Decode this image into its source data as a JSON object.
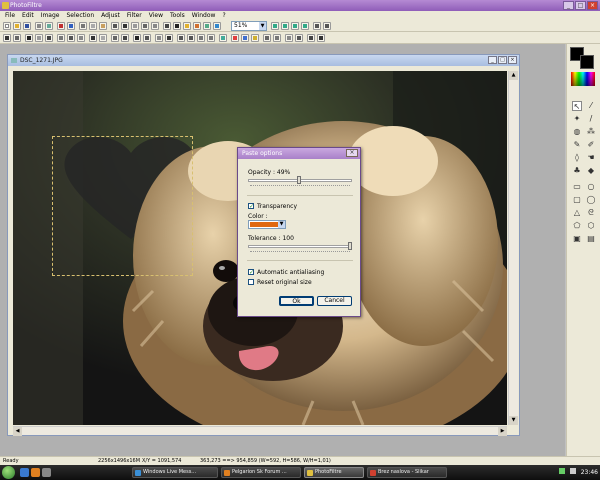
{
  "app": {
    "title": "PhotoFiltre"
  },
  "menu": [
    "File",
    "Edit",
    "Image",
    "Selection",
    "Adjust",
    "Filter",
    "View",
    "Tools",
    "Window",
    "?"
  ],
  "toolbar": {
    "zoom_value": "51%"
  },
  "document": {
    "title": "DSC_1271.JPG"
  },
  "dialog": {
    "title": "Paste options",
    "opacity_label": "Opacity : 49%",
    "opacity_value": 49,
    "transparency_label": "Transparency",
    "transparency_checked": true,
    "color_label": "Color :",
    "color_value": "#e06810",
    "tolerance_label": "Tolerance : 100",
    "tolerance_value": 100,
    "antialiasing_label": "Automatic antialiasing",
    "antialiasing_checked": true,
    "reset_size_label": "Reset original size",
    "reset_size_checked": false,
    "ok_label": "Ok",
    "cancel_label": "Cancel"
  },
  "status": {
    "ready": "Ready",
    "image_size": "2256x1496x16M",
    "cursor_pos": "X/Y = 1091,574",
    "selection_info": "363,273 ==> 954,859 (W=592, H=586, W/H=1,01)"
  },
  "taskbar": {
    "items": [
      {
        "label": "Windows Live Mess...",
        "icon": "messenger-icon",
        "color": "#3a90d8"
      },
      {
        "label": "Pelgarion Sk Forum ...",
        "icon": "browser-icon",
        "color": "#e08020"
      },
      {
        "label": "PhotoFiltre",
        "icon": "photofiltre-icon",
        "color": "#e0c040",
        "active": true
      },
      {
        "label": "Brez naslova - Slikar",
        "icon": "paint-icon",
        "color": "#d04030"
      }
    ],
    "clock": "23:46"
  },
  "colors": {
    "foreground": "#000000",
    "background": "#000000",
    "accent": "#a880c8"
  }
}
